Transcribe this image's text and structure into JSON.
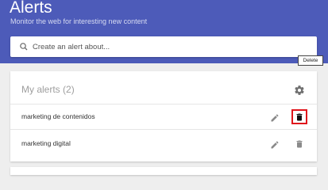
{
  "header": {
    "title": "Alerts",
    "subtitle": "Monitor the web for interesting new content"
  },
  "search": {
    "placeholder": "Create an alert about..."
  },
  "alerts_card": {
    "title": "My alerts",
    "count": "(2)",
    "items": [
      {
        "label": "marketing de contenidos"
      },
      {
        "label": "marketing digital"
      }
    ],
    "tooltip": "Delete"
  },
  "colors": {
    "header_bg": "#4d5bb9",
    "highlight_border": "#e0151b",
    "page_bg": "#eeeeee"
  },
  "icons": {
    "search": "search-icon",
    "settings": "gear-icon",
    "edit": "pencil-icon",
    "delete": "trash-icon"
  }
}
